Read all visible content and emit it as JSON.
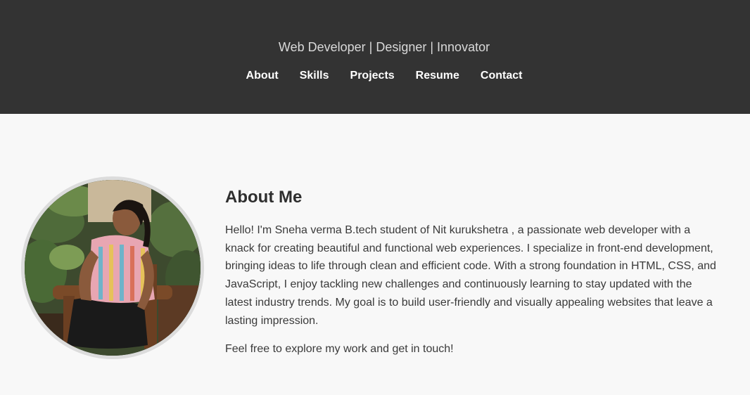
{
  "header": {
    "tagline": "Web Developer | Designer | Innovator",
    "nav": [
      {
        "label": "About"
      },
      {
        "label": "Skills"
      },
      {
        "label": "Projects"
      },
      {
        "label": "Resume"
      },
      {
        "label": "Contact"
      }
    ],
    "background_color": "#333333"
  },
  "about": {
    "title": "About Me",
    "paragraph1": "Hello! I'm Sneha verma B.tech student of Nit kurukshetra , a passionate web developer with a knack for creating beautiful and functional web experiences. I specialize in front-end development, bringing ideas to life through clean and efficient code. With a strong foundation in HTML, CSS, and JavaScript, I enjoy tackling new challenges and continuously learning to stay updated with the latest industry trends. My goal is to build user-friendly and visually appealing websites that leave a lasting impression.",
    "paragraph2": "Feel free to explore my work and get in touch!",
    "photo_icon": "profile-photo"
  }
}
